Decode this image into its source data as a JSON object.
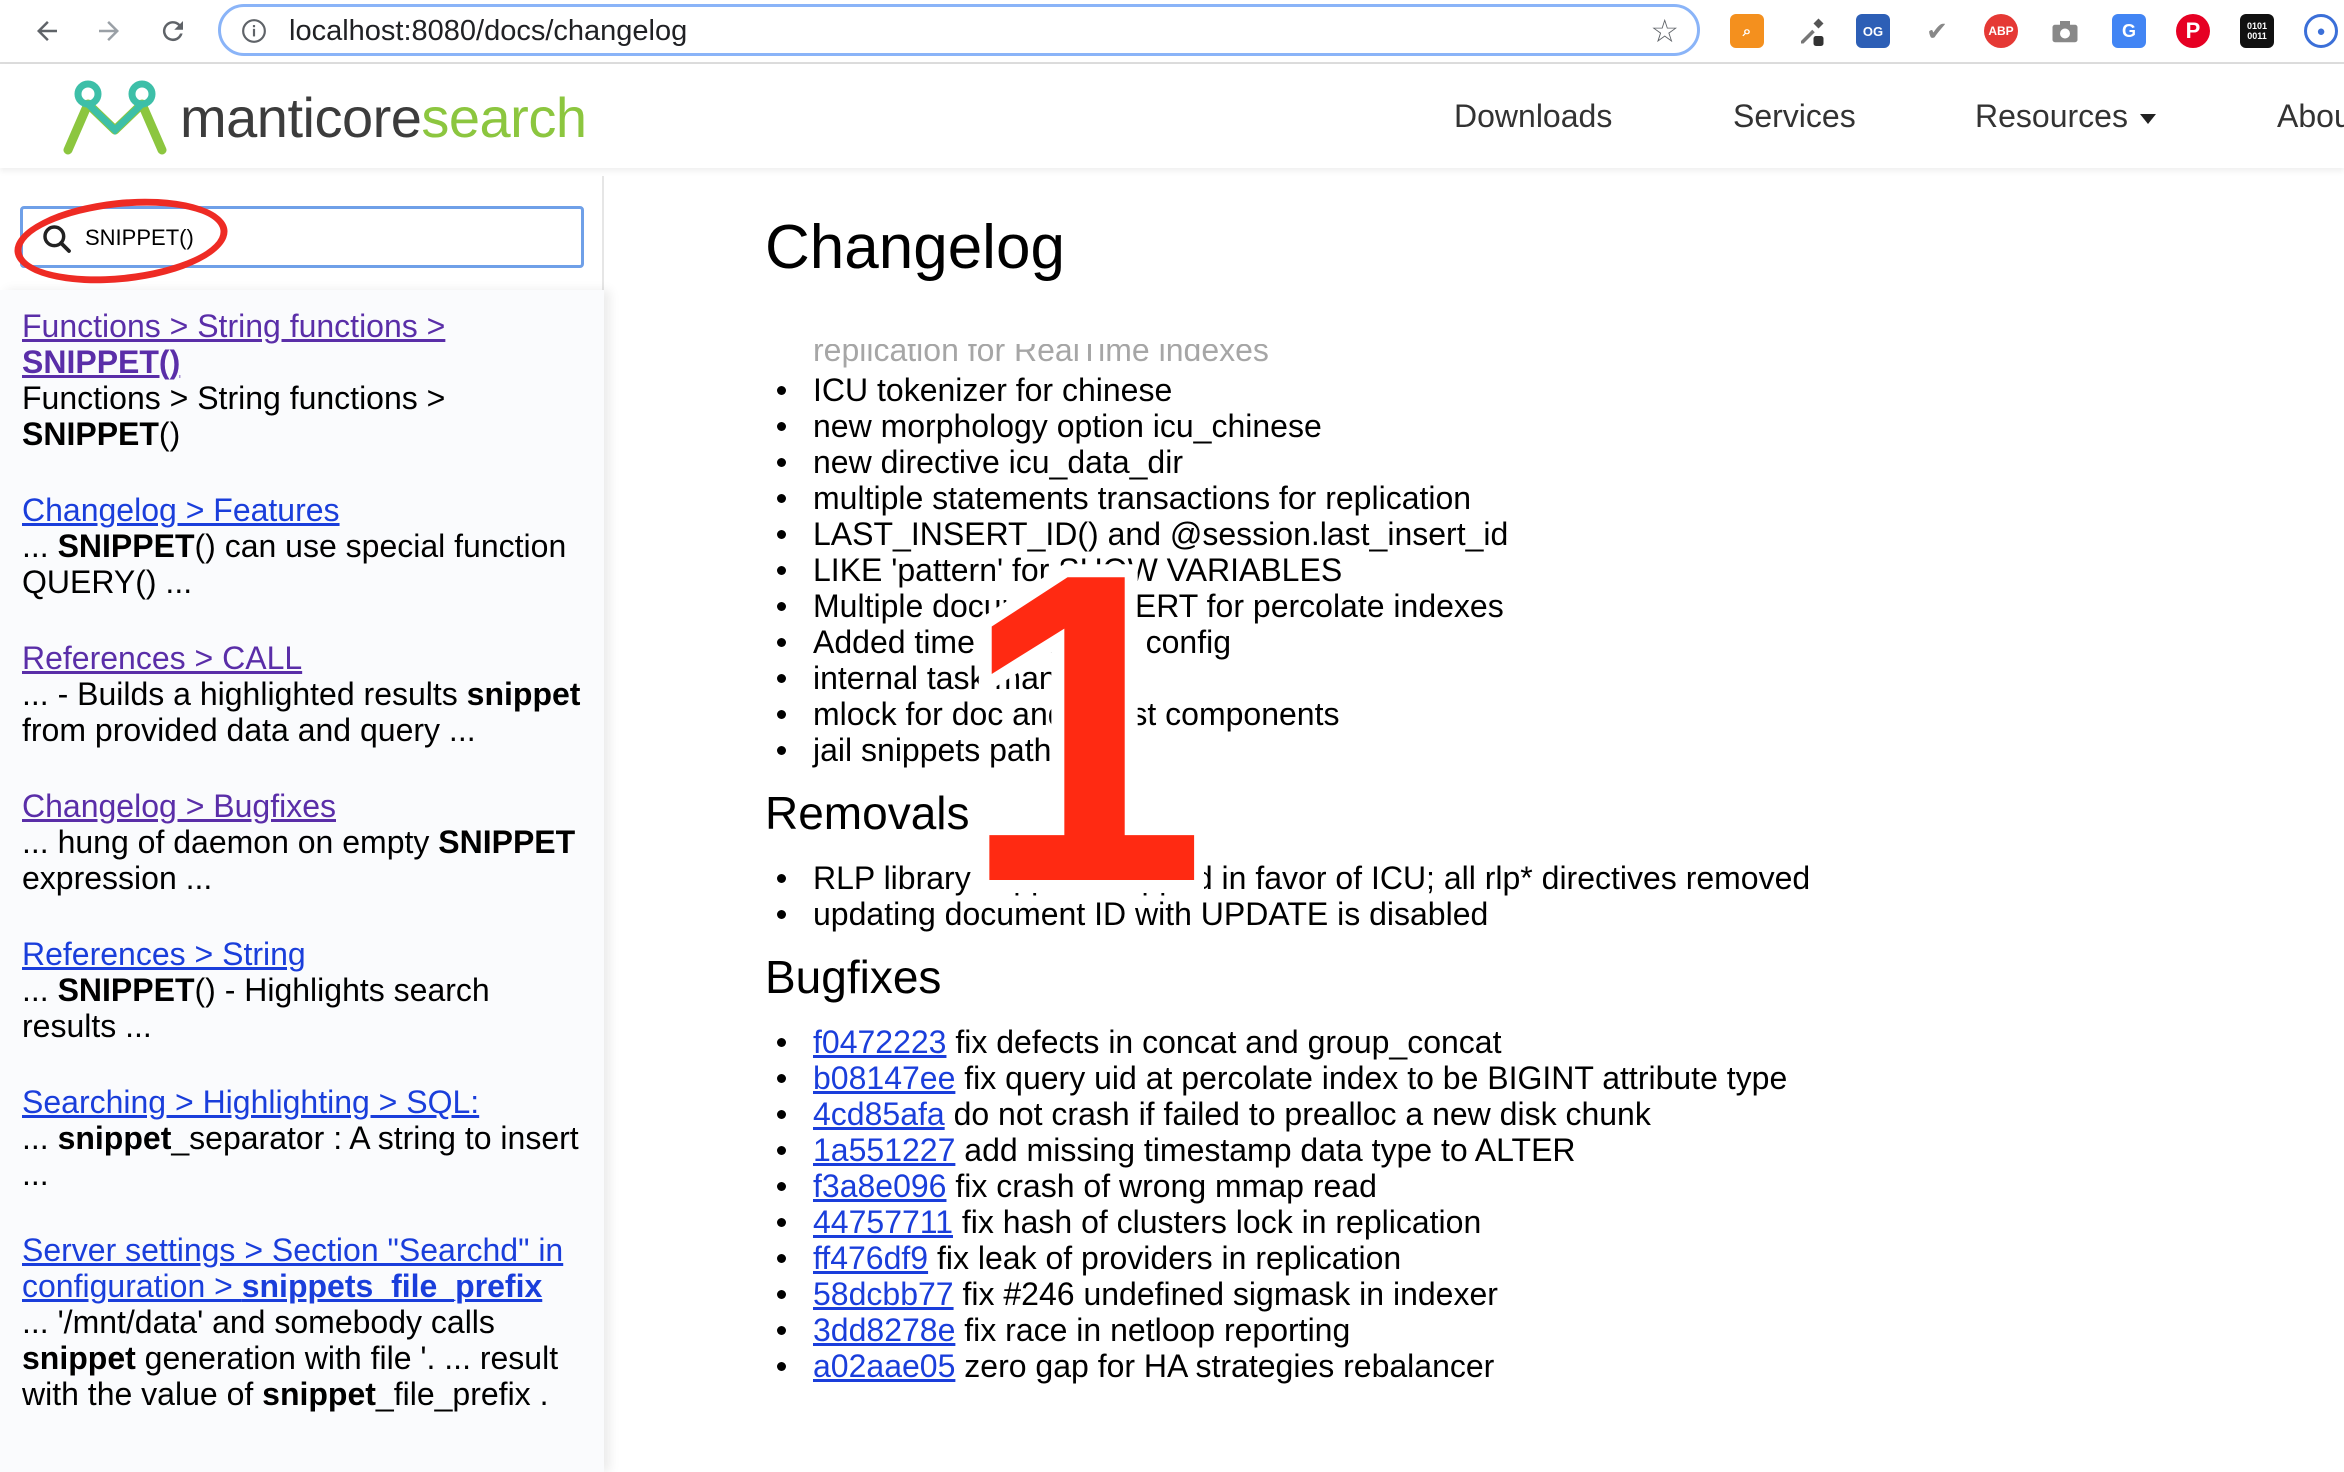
{
  "browser": {
    "url": "localhost:8080/docs/changelog",
    "extensions": [
      "search-ext-icon",
      "eyedropper-icon",
      "og-icon",
      "check-icon",
      "abp-icon",
      "camera-icon",
      "translate-icon",
      "pinterest-icon",
      "binary-icon",
      "profile-icon"
    ],
    "ext_labels": {
      "og": "OG",
      "abp": "ABP",
      "binary": "0101 0011"
    }
  },
  "site": {
    "logo_part1": "manticore",
    "logo_part2": "search",
    "nav": [
      "Downloads",
      "Services",
      "Resources",
      "Abou"
    ],
    "colors": {
      "brand_green": "#8cc63f",
      "link": "#1a3edb",
      "visited": "#5a2ea8",
      "annotation_red": "#ee2b24"
    }
  },
  "search": {
    "value": "SNIPPET()"
  },
  "results": [
    {
      "title_pre": "Functions > String functions > ",
      "title_bold": "SNIPPET()",
      "desc_pre": "Functions > String functions > ",
      "desc_bold": "SNIPPET",
      "desc_post": "()"
    },
    {
      "title": "Changelog > Features",
      "desc_pre": "... ",
      "desc_bold": "SNIPPET",
      "desc_post": "() can use special function QUERY() ..."
    },
    {
      "title": "References > CALL",
      "desc_pre": "... - Builds a highlighted results ",
      "desc_bold": "snippet",
      "desc_post": " from provided data and query ..."
    },
    {
      "title": "Changelog > Bugfixes",
      "desc_pre": "... hung of daemon on empty ",
      "desc_bold": "SNIPPET",
      "desc_post": " expression ..."
    },
    {
      "title": "References > String",
      "desc_pre": "... ",
      "desc_bold": "SNIPPET",
      "desc_post": "() - Highlights search results ..."
    },
    {
      "title": "Searching > Highlighting > SQL:",
      "desc_pre": "... ",
      "desc_bold": "snippet",
      "desc_post": "_separator : A string to insert ..."
    },
    {
      "title_pre": "Server settings > Section \"Searchd\" in configuration > ",
      "title_bold": "snippets_file_prefix",
      "desc_pre": "... '/mnt/data' and somebody calls ",
      "desc_bold": "snippet",
      "desc_mid": " generation with file '. ... result with the value of ",
      "desc_bold2": "snippet",
      "desc_post": "_file_prefix ."
    }
  ],
  "main": {
    "title": "Changelog",
    "faded_item": "replication for RealTime indexes",
    "features": [
      "ICU tokenizer for chinese",
      "new morphology option icu_chinese",
      "new directive icu_data_dir",
      "multiple statements transactions for replication",
      "LAST_INSERT_ID() and @session.last_insert_id",
      "LIKE 'pattern' for SHOW VARIABLES",
      "Multiple document INSERT for percolate indexes",
      "Added time parsers for config",
      "internal task manager",
      "mlock for doc and hit list components",
      "jail snippets path"
    ],
    "removals_title": "Removals",
    "removals": [
      "RLP library support dropped in favor of ICU; all rlp* directives removed",
      "updating document ID with UPDATE is disabled"
    ],
    "bugfixes_title": "Bugfixes",
    "bugfixes": [
      {
        "hash": "f0472223",
        "text": " fix defects in concat and group_concat"
      },
      {
        "hash": "b08147ee",
        "text": " fix query uid at percolate index to be BIGINT attribute type"
      },
      {
        "hash": "4cd85afa",
        "text": " do not crash if failed to prealloc a new disk chunk"
      },
      {
        "hash": "1a551227",
        "text": " add missing timestamp data type to ALTER"
      },
      {
        "hash": "f3a8e096",
        "text": " fix crash of wrong mmap read"
      },
      {
        "hash": "44757711",
        "text": " fix hash of clusters lock in replication"
      },
      {
        "hash": "ff476df9",
        "text": " fix leak of providers in replication"
      },
      {
        "hash": "58dcbb77",
        "text": " fix #246 undefined sigmask in indexer"
      },
      {
        "hash": "3dd8278e",
        "text": " fix race in netloop reporting"
      },
      {
        "hash": "a02aae05",
        "text": " zero gap for HA strategies rebalancer"
      }
    ]
  },
  "annotation": {
    "number": "1"
  }
}
